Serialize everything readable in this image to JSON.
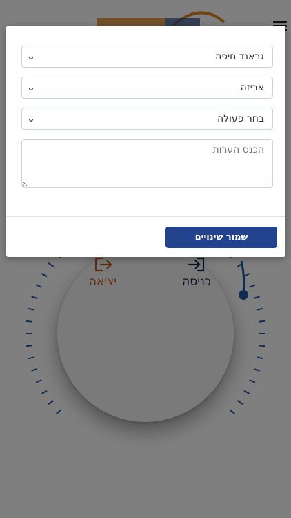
{
  "modal": {
    "branch_select": {
      "value": "גראנד חיפה"
    },
    "department_select": {
      "value": "אריזה"
    },
    "action_select": {
      "value": "בחר פעולה"
    },
    "notes": {
      "placeholder": "הכנס הערות",
      "value": ""
    },
    "save_label": "שמור שינויים"
  },
  "dial": {
    "exit_label": "יציאה",
    "enter_label": "כניסה"
  },
  "colors": {
    "primary": "#24438f",
    "exit_accent": "#c8561b",
    "enter_accent": "#1b2a4a",
    "tick_color": "#1f5aa6",
    "overlay": "rgba(0,0,0,0.5)"
  },
  "icons": {
    "menu": "hamburger-icon",
    "exit": "exit-arrow-icon",
    "enter": "enter-arrow-icon",
    "select": "chevron-down-icon",
    "resize": "resize-handle-icon"
  }
}
